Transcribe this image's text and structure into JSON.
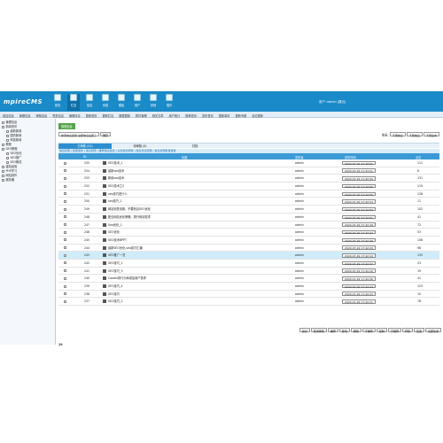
{
  "app": {
    "logo": "mpireCMS",
    "user_line": "用户: admin  [退出]"
  },
  "toolbar": [
    "首页",
    "栏目",
    "信息",
    "系统",
    "模板",
    "用户",
    "其他",
    "插件"
  ],
  "menubar": [
    "增加信息",
    "管理信息",
    "审核信息",
    "签发信息",
    "管理评论",
    "更新首页",
    "更新栏目",
    "数据更新",
    "附件管理",
    "相关文章",
    "用户统计",
    "推荐首页",
    "发布首页",
    "更新单页",
    "更新专题",
    "全站更新"
  ],
  "sidebar": {
    "items": [
      {
        "label": "管理信息",
        "level": 1
      },
      {
        "label": "新闻资讯",
        "level": 1
      },
      {
        "label": "最新新闻",
        "level": 2
      },
      {
        "label": "国内新闻",
        "level": 2
      },
      {
        "label": "科技新闻",
        "level": 2
      },
      {
        "label": "教程",
        "level": 1
      },
      {
        "label": "SEO教程",
        "level": 1
      },
      {
        "label": "SEO优化",
        "level": 2
      },
      {
        "label": "SEO推广",
        "level": 2
      },
      {
        "label": "SEO概念",
        "level": 2
      },
      {
        "label": "建站经验",
        "level": 1
      },
      {
        "label": "PHP学习",
        "level": 1
      },
      {
        "label": "网站制作",
        "level": 1
      },
      {
        "label": "服务器",
        "level": 1
      }
    ]
  },
  "main": {
    "badge": "管理信息",
    "filter_select": "搜索信息选项  全部信息设置了",
    "filter_btn": "确定",
    "right_label": "信息:",
    "right_selects": [
      "不限信息",
      "不限信息",
      "不限生成"
    ],
    "tabs": [
      "已审核 (24)",
      "待审核 (0)",
      "归档"
    ],
    "ops": "信息标题 | 批量发布 | 信息排序 | 推荐信息集合 | 头条信息转移 | 信息评论转移 | 信息标题批量替换",
    "columns": {
      "id": "ID",
      "title": "标题",
      "author": "发布者",
      "time": "发布时间",
      "views": "点击"
    },
    "rows": [
      {
        "id": "255",
        "title": "SEO技术_1",
        "author": "admin",
        "time": "2020-07-29 17:43:01",
        "views": "111"
      },
      {
        "id": "254",
        "title": "最新seo技术",
        "author": "admin",
        "time": "2020-07-29 17:43:01",
        "views": "8"
      },
      {
        "id": "253",
        "title": "新增seo技术",
        "author": "admin",
        "time": "2020-07-29 17:42:59",
        "views": "131"
      },
      {
        "id": "252",
        "title": "SEO技术之2",
        "author": "admin",
        "time": "2020-07-29 17:42:56",
        "views": "119"
      },
      {
        "id": "251",
        "title": "seo技巧是什么",
        "author": "admin",
        "time": "2020-07-29 17:42:55",
        "views": "128"
      },
      {
        "id": "250",
        "title": "seo技巧_1",
        "author": "admin",
        "time": "2020-07-29 17:42:54",
        "views": "11"
      },
      {
        "id": "249",
        "title": "网站标签设置、不要盲目SEO优化",
        "author": "admin",
        "time": "2020-07-29 17:42:53",
        "views": "102"
      },
      {
        "id": "248",
        "title": "配合网站优化策略、提升网站权重",
        "author": "admin",
        "time": "2020-07-29 17:42:51",
        "views": "41"
      },
      {
        "id": "247",
        "title": "Seo优化_1",
        "author": "admin",
        "time": "2020-07-29 17:42:49",
        "views": "72"
      },
      {
        "id": "246",
        "title": "SEO优化",
        "author": "admin",
        "time": "2020-07-29 17:42:47",
        "views": "53"
      },
      {
        "id": "245",
        "title": "SEO技术BPPT",
        "author": "admin",
        "time": "2020-07-29 17:42:40",
        "views": "108"
      },
      {
        "id": "244",
        "title": "最新SEO优化,seo技巧汇编",
        "author": "admin",
        "time": "2020-07-29 17:42:29",
        "views": "98"
      },
      {
        "id": "243",
        "title": "SEO推广一览",
        "author": "admin",
        "time": "2020-07-29 17:42:19",
        "views": "133"
      },
      {
        "id": "242",
        "title": "SEO技巧_1",
        "author": "admin",
        "time": "2020-07-29 17:42:37",
        "views": "23"
      },
      {
        "id": "241",
        "title": "SEO技巧_3",
        "author": "admin",
        "time": "2020-07-29 17:42:26",
        "views": "19"
      },
      {
        "id": "240",
        "title": "Coodel排行乐和增加用户需求",
        "author": "admin",
        "time": "2020-07-29 17:42:26",
        "views": "41"
      },
      {
        "id": "239",
        "title": "SEO技巧_4",
        "author": "admin",
        "time": "2020-07-29 17:42:24",
        "views": "123"
      },
      {
        "id": "238",
        "title": "SEO技巧",
        "author": "admin",
        "time": "2020-07-29 17:42:23",
        "views": "10"
      },
      {
        "id": "237",
        "title": "SEO技巧_2",
        "author": "admin",
        "time": "2020-07-29 17:42:21",
        "views": "78"
      }
    ],
    "highlight_row": 12,
    "bottom_buttons": [
      "提交",
      "取消审核",
      "推荐",
      "移动",
      "删除",
      "不推荐",
      "复制",
      "不推荐",
      "转移",
      "签发",
      "全部生成"
    ],
    "pager": "19"
  }
}
